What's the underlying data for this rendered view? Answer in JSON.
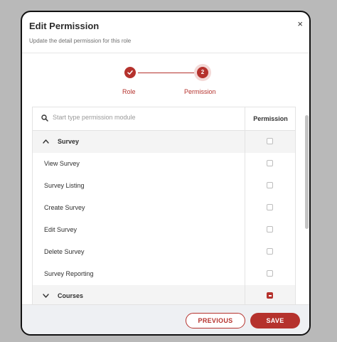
{
  "modal": {
    "title": "Edit Permission",
    "subtitle": "Update the detail permission for this role",
    "close_glyph": "×"
  },
  "stepper": {
    "steps": [
      {
        "label": "Role",
        "state": "completed",
        "icon": "check-icon"
      },
      {
        "label": "Permission",
        "number": "2",
        "state": "active"
      }
    ]
  },
  "table": {
    "search_placeholder": "Start type permission module",
    "permission_header": "Permission",
    "rows": [
      {
        "type": "group",
        "label": "Survey",
        "expanded": true,
        "checkbox": "unchecked"
      },
      {
        "type": "item",
        "label": "View Survey",
        "checkbox": "unchecked"
      },
      {
        "type": "item",
        "label": "Survey Listing",
        "checkbox": "unchecked"
      },
      {
        "type": "item",
        "label": "Create Survey",
        "checkbox": "unchecked"
      },
      {
        "type": "item",
        "label": "Edit Survey",
        "checkbox": "unchecked"
      },
      {
        "type": "item",
        "label": "Delete Survey",
        "checkbox": "unchecked"
      },
      {
        "type": "item",
        "label": "Survey Reporting",
        "checkbox": "unchecked"
      },
      {
        "type": "group",
        "label": "Courses",
        "expanded": false,
        "checkbox": "indeterminate"
      }
    ]
  },
  "footer": {
    "previous_label": "PREVIOUS",
    "save_label": "SAVE"
  },
  "colors": {
    "accent": "#b5322d",
    "backdrop": "#b9b9b9",
    "footer_bg": "#eef0f3",
    "group_row_bg": "#f4f4f4"
  }
}
